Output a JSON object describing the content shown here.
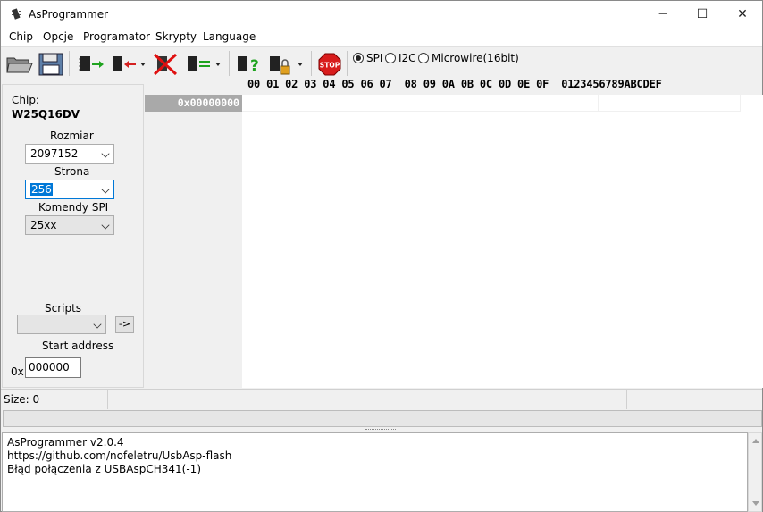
{
  "window": {
    "title": "AsProgrammer",
    "minimize_glyph": "─",
    "maximize_glyph": "☐",
    "close_glyph": "✕"
  },
  "menu": [
    "Chip",
    "Opcje",
    "Programator",
    "Skrypty",
    "Language"
  ],
  "toolbar": {
    "icons": [
      "open-file-icon",
      "save-file-icon",
      "read-chip-icon",
      "write-chip-icon",
      "erase-chip-icon",
      "verify-chip-icon",
      "check-blank-icon",
      "lock-chip-icon",
      "stop-icon"
    ],
    "stop_label": "STOP",
    "protocols": [
      {
        "label": "SPI",
        "selected": true
      },
      {
        "label": "I2C",
        "selected": false
      },
      {
        "label": "Microwire(16bit)",
        "selected": false
      }
    ]
  },
  "hex": {
    "header": "00 01 02 03 04 05 06 07  08 09 0A 0B 0C 0D 0E 0F  0123456789ABCDEF",
    "address": "0x00000000"
  },
  "panel": {
    "chip_label": "Chip:",
    "chip_name": "W25Q16DV",
    "size_label": "Rozmiar",
    "size_value": "2097152",
    "page_label": "Strona",
    "page_value": "256",
    "spi_cmd_label": "Komendy SPI",
    "spi_cmd_value": "25xx",
    "scripts_label": "Scripts",
    "scripts_value": "",
    "run_button": "->",
    "start_address_label": "Start address",
    "hex_prefix": "0x",
    "start_address_value": "000000"
  },
  "status": {
    "size_text": "Size: 0"
  },
  "log": [
    "AsProgrammer v2.0.4",
    "https://github.com/nofeletru/UsbAsp-flash",
    "Błąd połączenia z USBAspCH341(-1)"
  ]
}
